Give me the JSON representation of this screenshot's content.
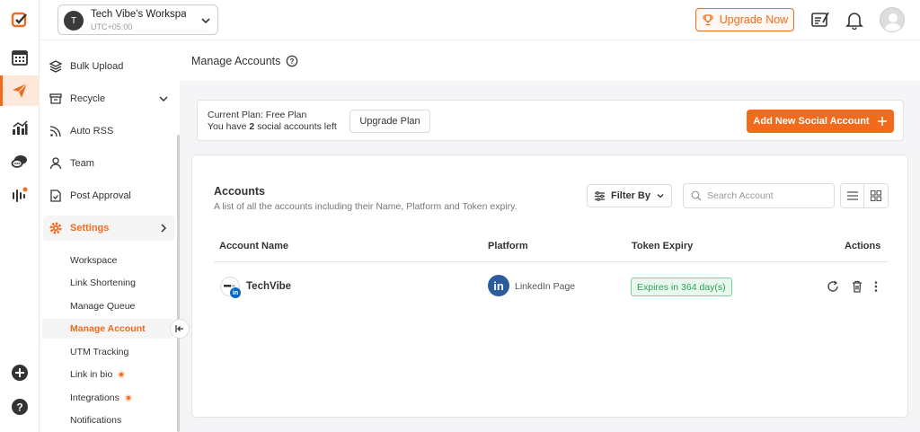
{
  "rail": {
    "items": [
      "logo",
      "calendar",
      "publish",
      "analytics",
      "inbox",
      "listening",
      "add",
      "help"
    ]
  },
  "header": {
    "workspace_initial": "T",
    "workspace_name": "Tech Vibe's Workspace",
    "workspace_tz": "UTC+05:00",
    "upgrade_label": "Upgrade Now"
  },
  "sidebar": {
    "items": [
      {
        "label": "Bulk Upload"
      },
      {
        "label": "Recycle"
      },
      {
        "label": "Auto RSS"
      },
      {
        "label": "Team"
      },
      {
        "label": "Post Approval"
      },
      {
        "label": "Settings"
      }
    ],
    "sub_items": [
      {
        "label": "Workspace"
      },
      {
        "label": "Link Shortening"
      },
      {
        "label": "Manage Queue"
      },
      {
        "label": "Manage Account"
      },
      {
        "label": "UTM Tracking"
      },
      {
        "label": "Link in bio"
      },
      {
        "label": "Integrations"
      },
      {
        "label": "Notifications"
      }
    ]
  },
  "page": {
    "title": "Manage Accounts"
  },
  "plan": {
    "line1_label": "Current Plan:",
    "line1_value": "Free Plan",
    "line2_prefix": "You have",
    "line2_count": "2",
    "line2_suffix": "social accounts left",
    "upgrade_plan_label": "Upgrade Plan",
    "add_account_label": "Add New Social Account"
  },
  "accounts": {
    "title": "Accounts",
    "subtitle": "A list of all the accounts including their Name, Platform and Token expiry.",
    "filter_label": "Filter By",
    "search_placeholder": "Search Account",
    "columns": [
      "Account Name",
      "Platform",
      "Token Expiry",
      "Actions"
    ],
    "rows": [
      {
        "name": "TechVibe",
        "platform_icon": "in",
        "platform": "LinkedIn Page",
        "expiry": "Expires in 364 day(s)"
      }
    ]
  },
  "colors": {
    "accent": "#f26b1d",
    "linkedin": "#2b5c9c",
    "success": "#2aa351"
  }
}
